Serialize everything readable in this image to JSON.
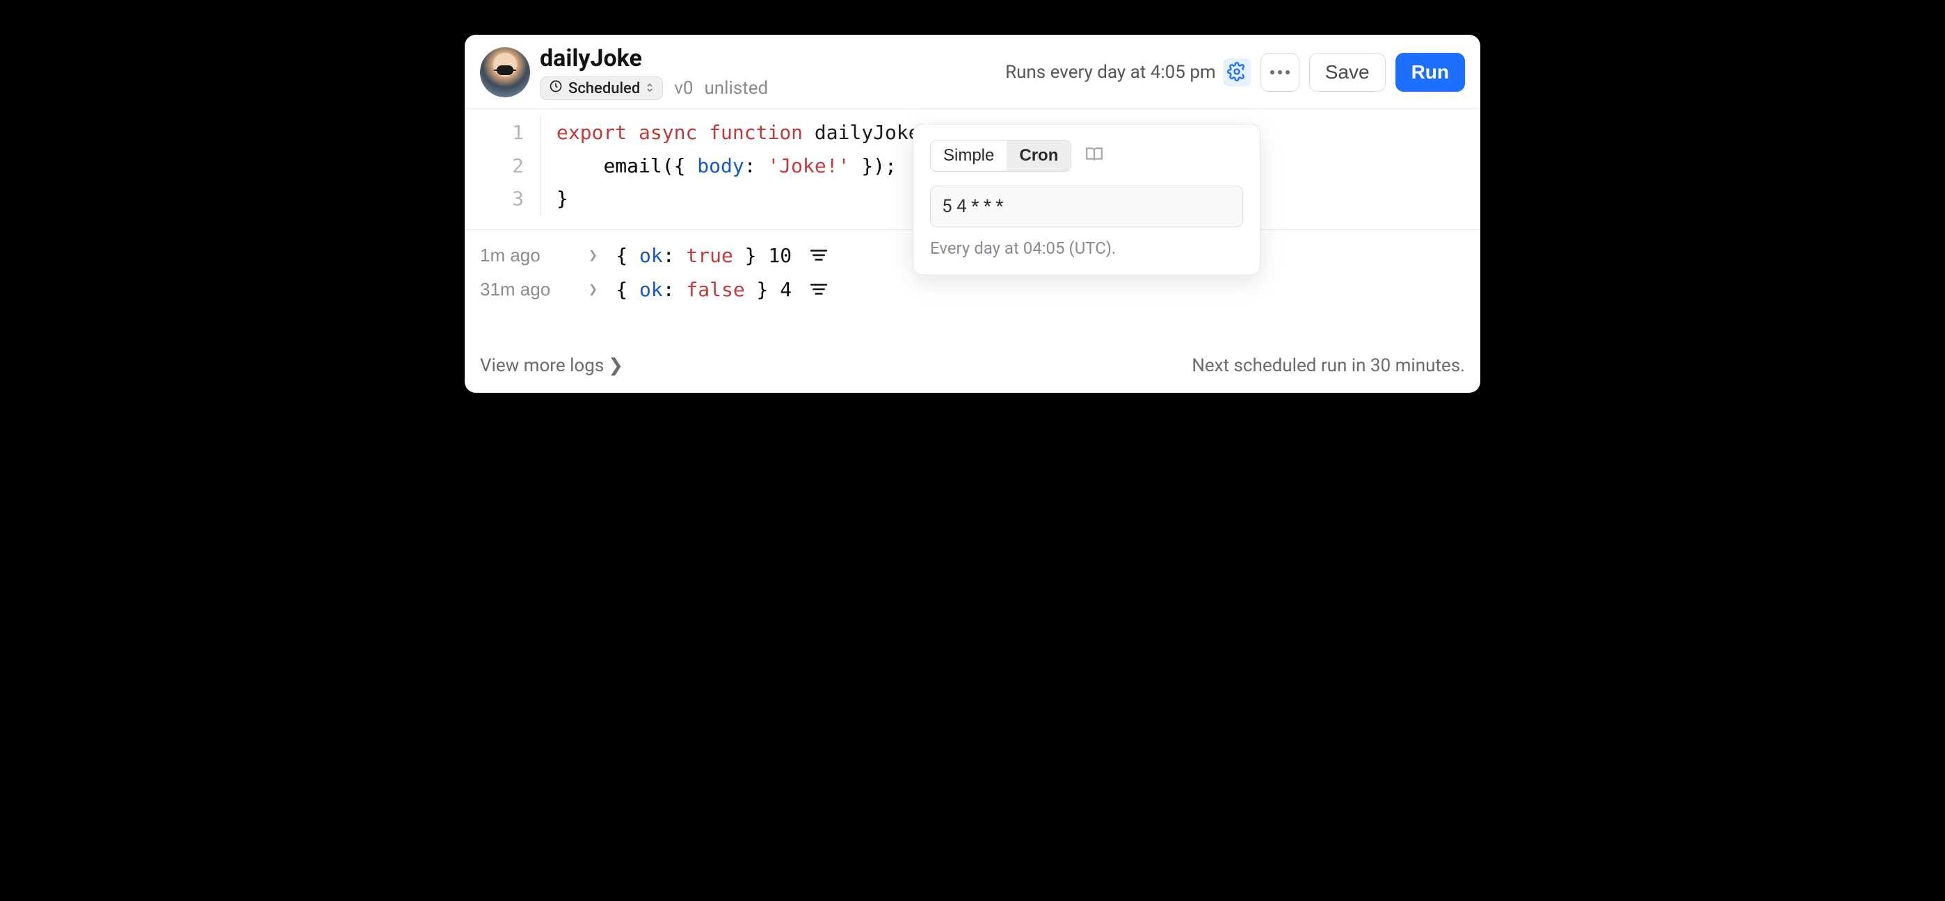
{
  "header": {
    "title": "dailyJoke",
    "badge_label": "Scheduled",
    "version": "v0",
    "visibility": "unlisted",
    "schedule_text": "Runs every day at 4:05 pm",
    "more_label": "More",
    "save_label": "Save",
    "run_label": "Run"
  },
  "popover": {
    "tab_simple": "Simple",
    "tab_cron": "Cron",
    "cron_value": "5 4 * * *",
    "description": "Every day at 04:05 (UTC)."
  },
  "code": {
    "line1": {
      "n": "1",
      "k1": "export",
      "k2": "async",
      "k3": "function",
      "fn": " dailyJoke() {"
    },
    "line2": {
      "n": "2",
      "indent": "    ",
      "call": "email({ ",
      "prop": "body",
      "mid": ": ",
      "str": "'Joke!'",
      "end": " });"
    },
    "line3": {
      "n": "3",
      "txt": "}"
    }
  },
  "logs": [
    {
      "time": "1m ago",
      "ok_label": "ok",
      "ok_value": "true",
      "count": "10"
    },
    {
      "time": "31m ago",
      "ok_label": "ok",
      "ok_value": "false",
      "count": "4"
    }
  ],
  "footer": {
    "more_logs": "View more logs",
    "next_run": "Next scheduled run in 30 minutes."
  }
}
